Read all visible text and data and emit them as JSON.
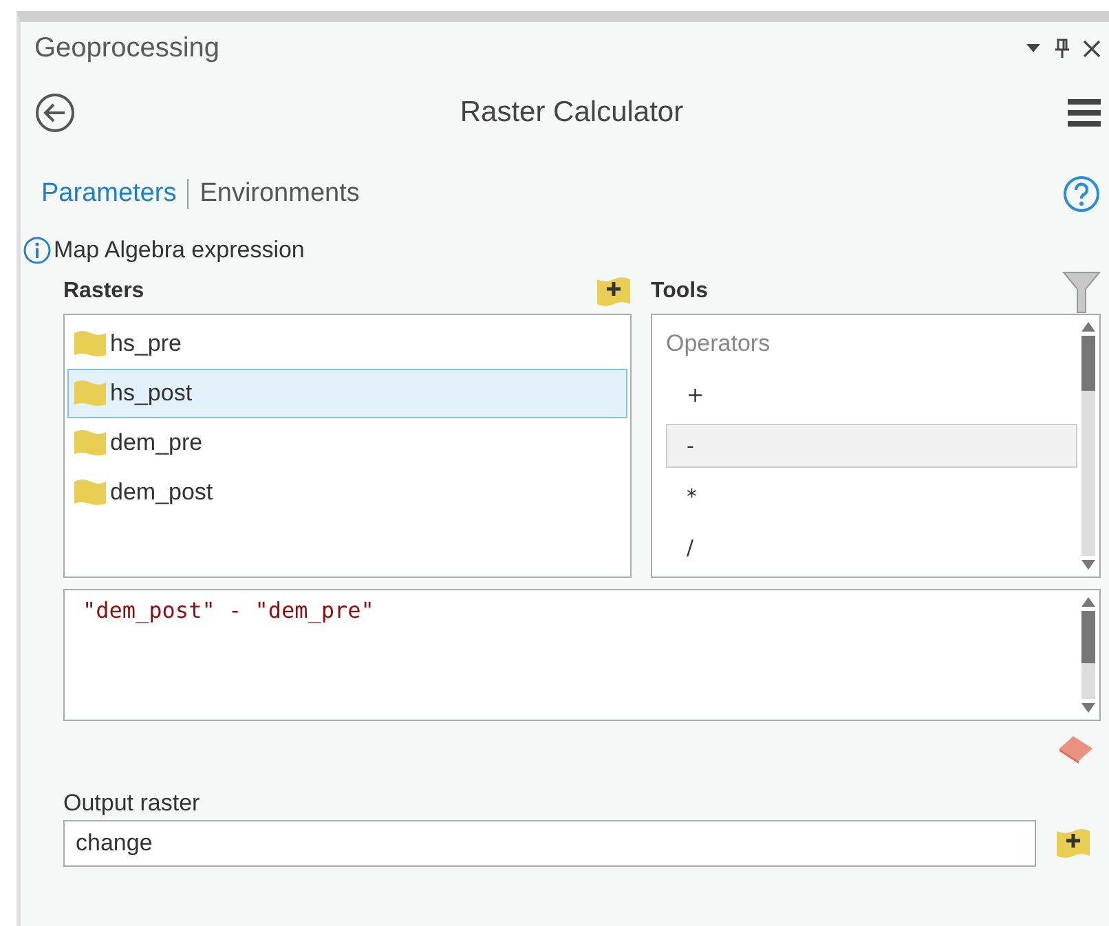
{
  "window": {
    "title": "Geoprocessing"
  },
  "tool": {
    "title": "Raster Calculator"
  },
  "tabs": [
    {
      "label": "Parameters",
      "selected": true
    },
    {
      "label": "Environments",
      "selected": false
    }
  ],
  "expression_section": {
    "label": "Map Algebra expression"
  },
  "rasters": {
    "label": "Rasters",
    "items": [
      {
        "name": "hs_pre",
        "selected": false
      },
      {
        "name": "hs_post",
        "selected": true
      },
      {
        "name": "dem_pre",
        "selected": false
      },
      {
        "name": "dem_post",
        "selected": false
      }
    ]
  },
  "tools": {
    "label": "Tools",
    "group": "Operators",
    "items": [
      {
        "label": "+",
        "selected": false
      },
      {
        "label": "-",
        "selected": true
      },
      {
        "label": "*",
        "selected": false
      },
      {
        "label": "/",
        "selected": false
      }
    ]
  },
  "expression": "\"dem_post\" - \"dem_pre\"",
  "output": {
    "label": "Output raster",
    "value": "change"
  }
}
